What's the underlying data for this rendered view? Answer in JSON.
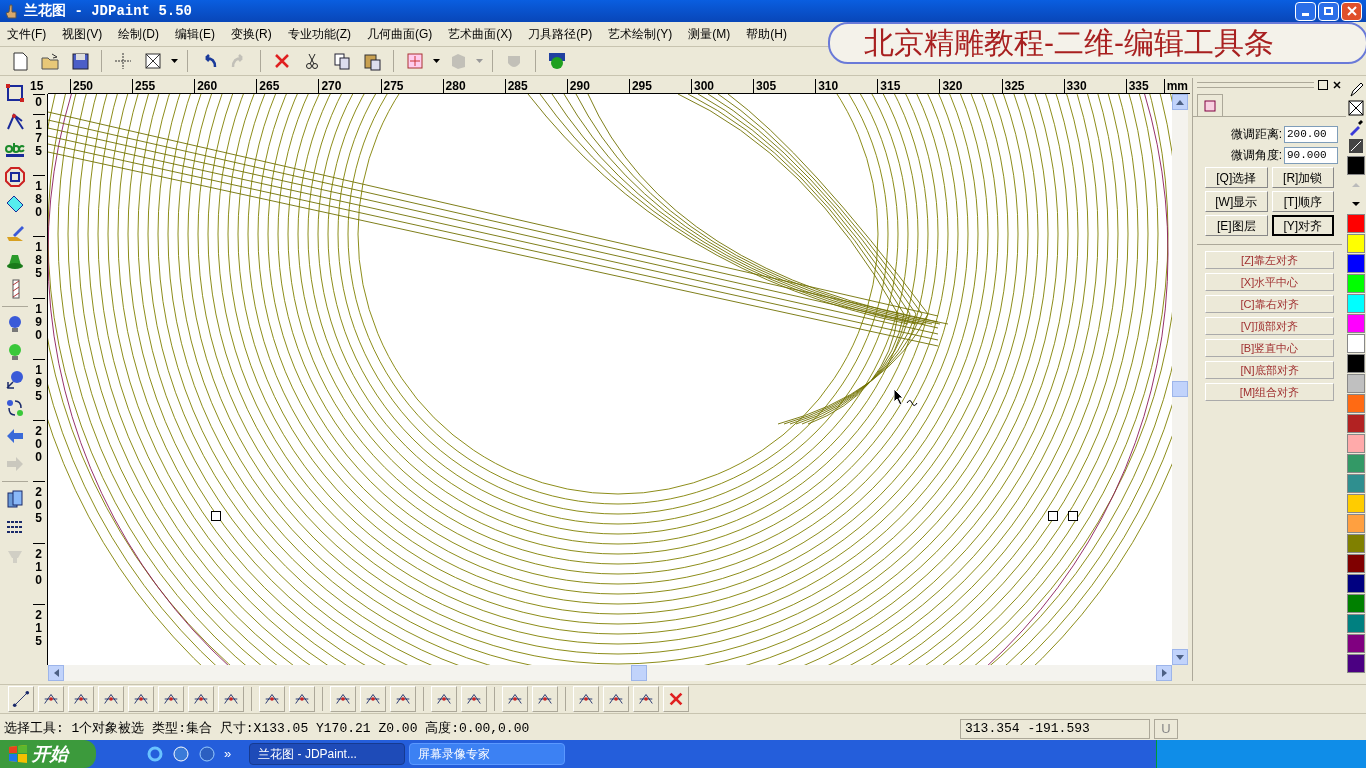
{
  "window": {
    "title": "兰花图 - JDPaint 5.50"
  },
  "menu": [
    "文件(F)",
    "视图(V)",
    "绘制(D)",
    "编辑(E)",
    "变换(R)",
    "专业功能(Z)",
    "几何曲面(G)",
    "艺术曲面(X)",
    "刀具路径(P)",
    "艺术绘制(Y)",
    "测量(M)",
    "帮助(H)"
  ],
  "banner": {
    "text": "北京精雕教程-二维-编辑工具条"
  },
  "toolbar": [
    {
      "disabled": false
    },
    {
      "disabled": false
    },
    {
      "disabled": false
    },
    {
      "disabled": false
    },
    {
      "disabled": false
    },
    {
      "disabled": false
    },
    {
      "disabled": true
    },
    {
      "disabled": false
    },
    {
      "disabled": false
    },
    {
      "disabled": false
    },
    {
      "disabled": false
    },
    {
      "disabled": false
    },
    {
      "disabled": true
    },
    {
      "disabled": true
    },
    {
      "disabled": false
    }
  ],
  "left_tools": [
    {
      "disabled": false
    },
    {
      "disabled": false
    },
    {
      "disabled": false
    },
    {
      "disabled": false
    },
    {
      "disabled": false
    },
    {
      "disabled": false
    },
    {
      "disabled": false
    },
    {
      "disabled": false
    },
    {
      "disabled": false
    },
    {
      "disabled": false
    },
    {
      "disabled": false
    },
    {
      "disabled": false
    },
    {
      "disabled": false
    },
    {
      "disabled": true
    },
    {
      "disabled": false
    },
    {
      "disabled": false
    },
    {
      "disabled": true
    }
  ],
  "horizontal_ruler": {
    "corner": "15",
    "labels": [
      "250",
      "255",
      "260",
      "265",
      "270",
      "275",
      "280",
      "285",
      "290",
      "295",
      "300",
      "305",
      "310",
      "315",
      "320",
      "325",
      "330",
      "335"
    ],
    "unit": "mm"
  },
  "vertical_ruler": {
    "labels": [
      "0",
      "175",
      "180",
      "185",
      "190",
      "195",
      "200",
      "205",
      "210",
      "215"
    ]
  },
  "panel": {
    "fields": [
      {
        "label": "微调距离:",
        "value": "200.00"
      },
      {
        "label": "微调角度:",
        "value": "90.000"
      }
    ],
    "modes": [
      {
        "label": "[Q]选择",
        "selected": false
      },
      {
        "label": "[R]加锁",
        "selected": false
      },
      {
        "label": "[W]显示",
        "selected": false
      },
      {
        "label": "[T]顺序",
        "selected": false
      },
      {
        "label": "[E]图层",
        "selected": false
      },
      {
        "label": "[Y]对齐",
        "selected": true
      }
    ],
    "actions": [
      "[Z]靠左对齐",
      "[X]水平中心",
      "[C]靠右对齐",
      "[V]顶部对齐",
      "[B]竖直中心",
      "[N]底部对齐",
      "[M]组合对齐"
    ]
  },
  "palette": [
    {
      "color": "#000000"
    },
    {
      "color": "#ff0000"
    },
    {
      "color": "#ffff00"
    },
    {
      "color": "#0000ff"
    },
    {
      "color": "#00ff00"
    },
    {
      "color": "#00ffff"
    },
    {
      "color": "#ff00ff"
    },
    {
      "color": "#ffffff"
    },
    {
      "color": "#000000"
    },
    {
      "color": "#c0c0c0"
    },
    {
      "color": "#ff6a13"
    },
    {
      "color": "#b22222"
    },
    {
      "color": "#ffaaaa"
    },
    {
      "color": "#339966"
    },
    {
      "color": "#2f8f8f"
    },
    {
      "color": "#ffcc00"
    },
    {
      "color": "#ffa040"
    },
    {
      "color": "#808000"
    },
    {
      "color": "#800000"
    },
    {
      "color": "#000080"
    },
    {
      "color": "#008000"
    },
    {
      "color": "#008080"
    },
    {
      "color": "#800080"
    },
    {
      "color": "#4b0082"
    }
  ],
  "status_bar": {
    "message": "选择工具: 1个对象被选 类型:集合 尺寸:X133.05 Y170.21 Z0.00 高度:0.00,0.00",
    "coordinates": "313.354 -191.593",
    "unit_button": "U"
  },
  "taskbar": {
    "start": "开始",
    "more": "»",
    "tasks": [
      {
        "label": "兰花图 - JDPaint...",
        "selected": true
      },
      {
        "label": "屏幕录像专家",
        "selected": false
      }
    ]
  }
}
